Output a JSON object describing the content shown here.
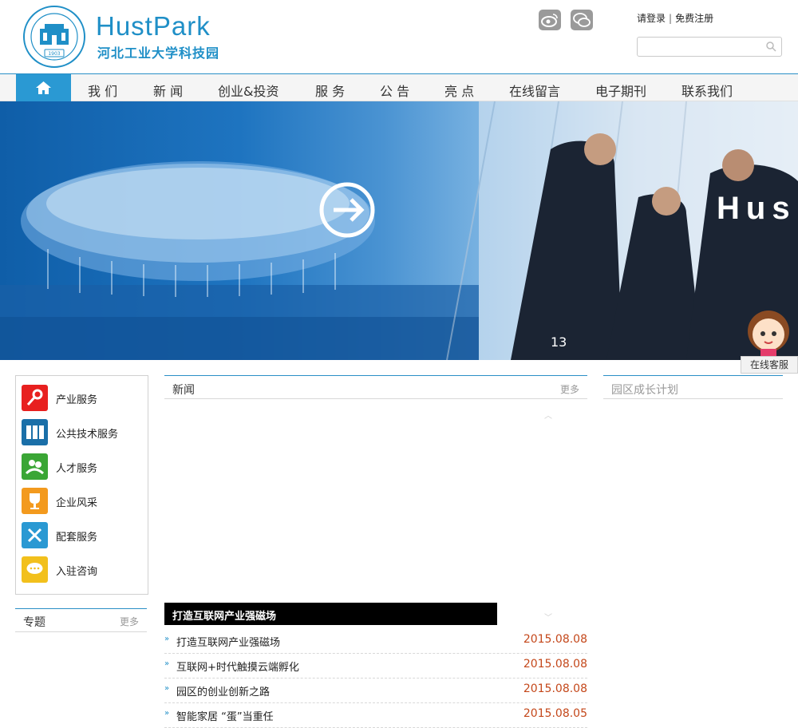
{
  "header": {
    "logo_en": "HustPark",
    "logo_cn": "河北工业大学科技园",
    "logo_year": "1903",
    "login": "请登录",
    "register": "免费注册",
    "search_placeholder": ""
  },
  "nav": {
    "items": [
      "我 们",
      "新 闻",
      "创业&投资",
      "服 务",
      "公 告",
      "亮 点",
      "在线留言",
      "电子期刊",
      "联系我们"
    ]
  },
  "banner": {
    "text": "Hus",
    "number": "13"
  },
  "kefu": {
    "label": "在线客服"
  },
  "sidebar": {
    "items": [
      {
        "label": "产业服务",
        "icon": "key-icon",
        "color": "#e8201f"
      },
      {
        "label": "公共技术服务",
        "icon": "binders-icon",
        "color": "#1a6fa8"
      },
      {
        "label": "人才服务",
        "icon": "people-icon",
        "color": "#3aa635"
      },
      {
        "label": "企业风采",
        "icon": "trophy-icon",
        "color": "#f39a1e"
      },
      {
        "label": "配套服务",
        "icon": "tools-icon",
        "color": "#2a99d3"
      },
      {
        "label": "入驻咨询",
        "icon": "chat-icon",
        "color": "#f2c01c"
      }
    ],
    "topic_title": "专题",
    "topic_more": "更多"
  },
  "news": {
    "title": "新闻",
    "more": "更多",
    "feature": "打造互联网产业强磁场",
    "items": [
      {
        "title": "打造互联网产业强磁场",
        "date": "2015.08.08"
      },
      {
        "title": "互联网+时代触摸云端孵化",
        "date": "2015.08.08"
      },
      {
        "title": "园区的创业创新之路",
        "date": "2015.08.08"
      },
      {
        "title": "智能家居 “蛋”当重任",
        "date": "2015.08.05"
      }
    ]
  },
  "park": {
    "title": "园区成长计划"
  }
}
